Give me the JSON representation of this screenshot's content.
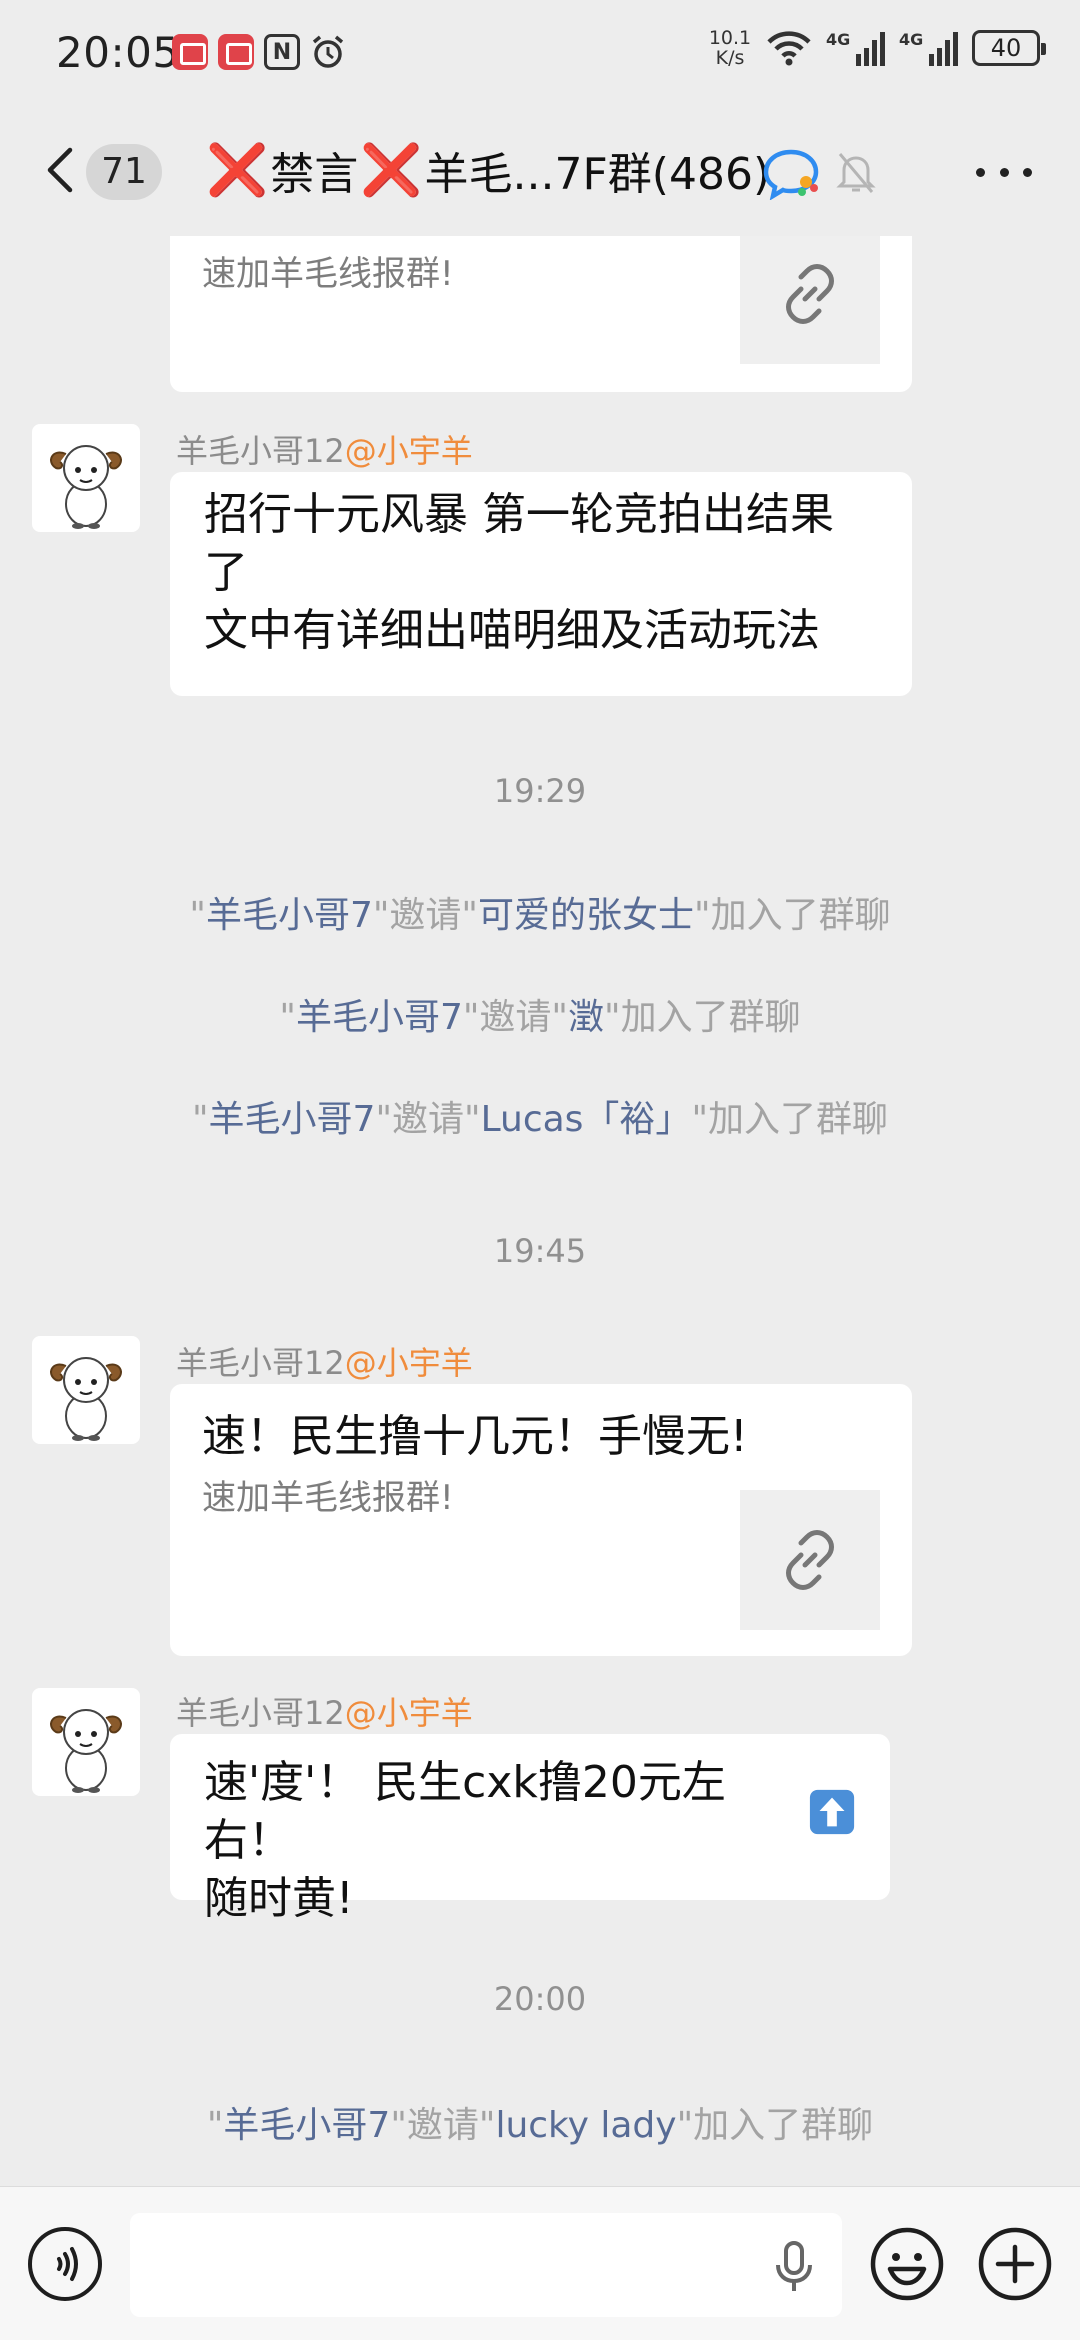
{
  "status_bar": {
    "time": "20:05",
    "net_speed_value": "10.1",
    "net_speed_unit": "K/s",
    "signal_labels": [
      "4G",
      "4G"
    ],
    "battery": "40"
  },
  "header": {
    "unread_count": "71",
    "title_parts": [
      "❌",
      "禁言",
      "❌",
      "羊毛...7F群(486)"
    ]
  },
  "messages": [
    {
      "sub_text": "速加羊毛线报群!"
    },
    {
      "sender_name": "羊毛小哥12",
      "sender_tag": "@小宇羊",
      "lines": [
        "招行十元风暴 第一轮竞拍出结果",
        "了",
        "文中有详细出喵明细及活动玩法"
      ]
    },
    {
      "sender_name": "羊毛小哥12",
      "sender_tag": "@小宇羊",
      "text": "速！民生撸十几元！手慢无!",
      "sub_text": "速加羊毛线报群!"
    },
    {
      "sender_name": "羊毛小哥12",
      "sender_tag": "@小宇羊",
      "line1": "速'度'！ 民生cxk撸20元左右！",
      "line2": "随时黄!"
    }
  ],
  "timestamps": [
    "19:29",
    "19:45",
    "20:00"
  ],
  "system_messages": [
    {
      "q1": "\"",
      "inviter": "羊毛小哥7",
      "mid": "\"邀请\"",
      "invitee": "可爱的张女士",
      "end": "\"加入了群聊"
    },
    {
      "q1": "\"",
      "inviter": "羊毛小哥7",
      "mid": "\"邀请\"",
      "invitee": "澂",
      "end": "\"加入了群聊"
    },
    {
      "q1": "\"",
      "inviter": "羊毛小哥7",
      "mid": "\"邀请\"",
      "invitee": "Lucas「裕」",
      "end": "\"加入了群聊"
    },
    {
      "q1": "\"",
      "inviter": "羊毛小哥7",
      "mid": "\"邀请\"",
      "invitee": "lucky lady",
      "end": "\"加入了群聊"
    }
  ],
  "input": {
    "placeholder": ""
  },
  "colors": {
    "background": "#ededed",
    "bubble": "#ffffff",
    "link_name": "#576b95",
    "at_tag": "#f08c3c",
    "red_x": "#e12b2b"
  },
  "icons": [
    "back-icon",
    "chat-bubble-icon",
    "mute-bell-icon",
    "more-icon",
    "link-icon",
    "voice-icon",
    "mic-icon",
    "emoji-icon",
    "plus-icon"
  ]
}
